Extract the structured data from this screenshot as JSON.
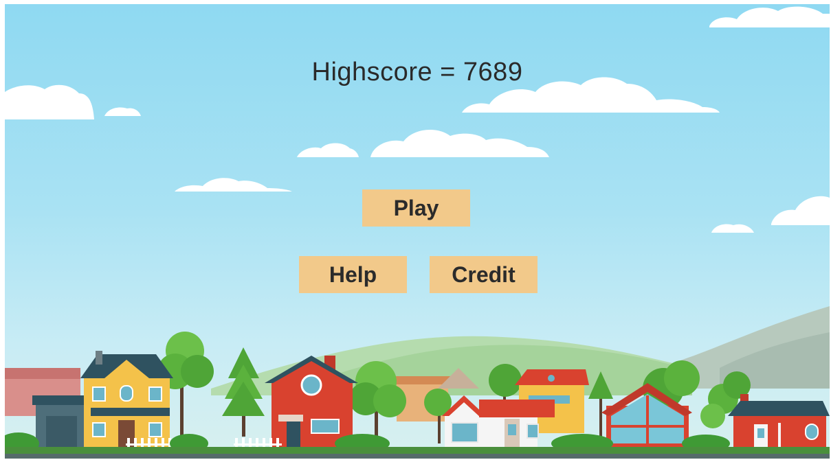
{
  "score": {
    "text": "Highscore = 7689"
  },
  "menu": {
    "play_label": "Play",
    "help_label": "Help",
    "credit_label": "Credit"
  },
  "colors": {
    "button": "#f2c98a",
    "sky_top": "#8fd9f2",
    "ground": "#4a8f3c"
  }
}
